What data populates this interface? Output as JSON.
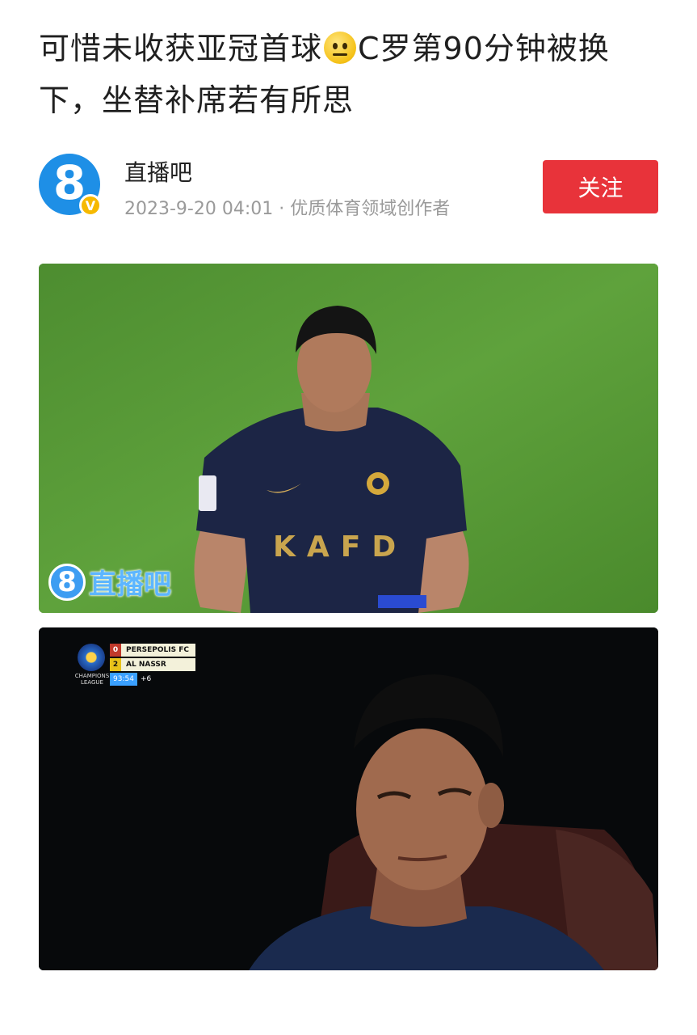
{
  "article": {
    "title_part1": "可惜未收获亚冠首球",
    "title_emoji": "neutral-face-emoji",
    "title_part2": "C罗第90分钟被换下，坐替补席若有所思"
  },
  "author": {
    "name": "直播吧",
    "avatar_text": "8",
    "verified_badge": "V",
    "meta": "2023-9-20 04:01 · 优质体育领域创作者",
    "follow_label": "关注"
  },
  "images": {
    "watermark_logo": "8",
    "watermark_text": "直播吧",
    "jersey_text": "KAFD",
    "scoreboard": {
      "league_logo_text": "CHAMPIONS LEAGUE",
      "team1_score": "0",
      "team1_name": "PERSEPOLIS FC",
      "team2_score": "2",
      "team2_name": "AL NASSR",
      "clock": "93:54",
      "added_time": "+6"
    }
  },
  "colors": {
    "follow_button": "#e8333a",
    "avatar_blue": "#1e8fe6",
    "badge_gold": "#f6b900",
    "meta_gray": "#9a9a9a"
  }
}
